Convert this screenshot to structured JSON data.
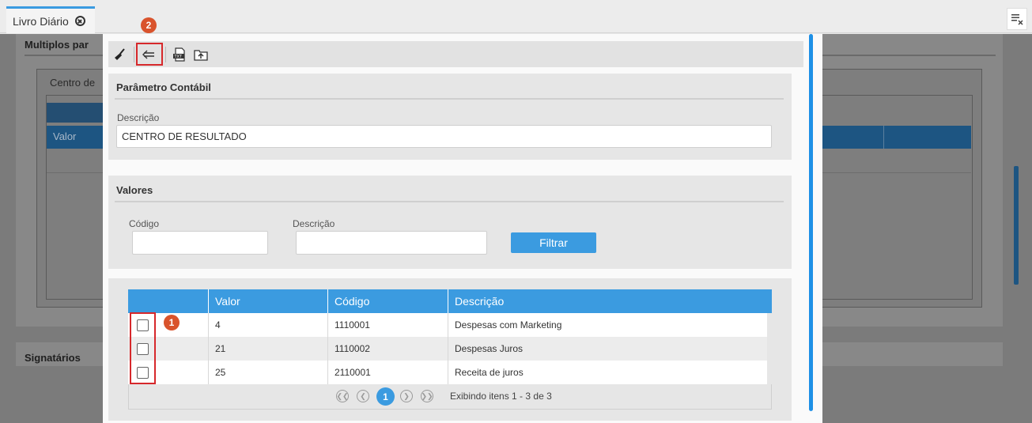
{
  "tabs": [
    {
      "label": "Livro Diário"
    }
  ],
  "background": {
    "section1_title": "Multiplos par",
    "section1_sub": "Centro de",
    "section1_column": "Valor",
    "section2_title": "Signatários"
  },
  "modal": {
    "toolbar": {
      "clear_icon": "broom-icon",
      "back_icon": "back-arrow-icon",
      "export_icon": "txt-export-icon",
      "upload_icon": "folder-upload-icon"
    },
    "param_section": {
      "title": "Parâmetro Contábil",
      "descricao_label": "Descrição",
      "descricao_value": "CENTRO DE RESULTADO"
    },
    "values_section": {
      "title": "Valores",
      "codigo_label": "Código",
      "codigo_value": "",
      "descricao_label": "Descrição",
      "descricao_value": "",
      "filter_button": "Filtrar"
    },
    "grid": {
      "columns": [
        "Valor",
        "Código",
        "Descrição"
      ],
      "rows": [
        {
          "valor": "4",
          "codigo": "1110001",
          "descricao": "Despesas com Marketing",
          "checked": false
        },
        {
          "valor": "21",
          "codigo": "1110002",
          "descricao": "Despesas Juros",
          "checked": false
        },
        {
          "valor": "25",
          "codigo": "2110001",
          "descricao": "Receita de juros",
          "checked": false
        }
      ],
      "pager": {
        "current_page": "1",
        "info": "Exibindo itens 1 - 3 de 3"
      }
    },
    "annotations": {
      "badge1": "1",
      "badge2": "2"
    }
  },
  "colors": {
    "accent": "#3b9be0",
    "annotation_red": "#d6282b",
    "badge_orange": "#d9532c"
  }
}
